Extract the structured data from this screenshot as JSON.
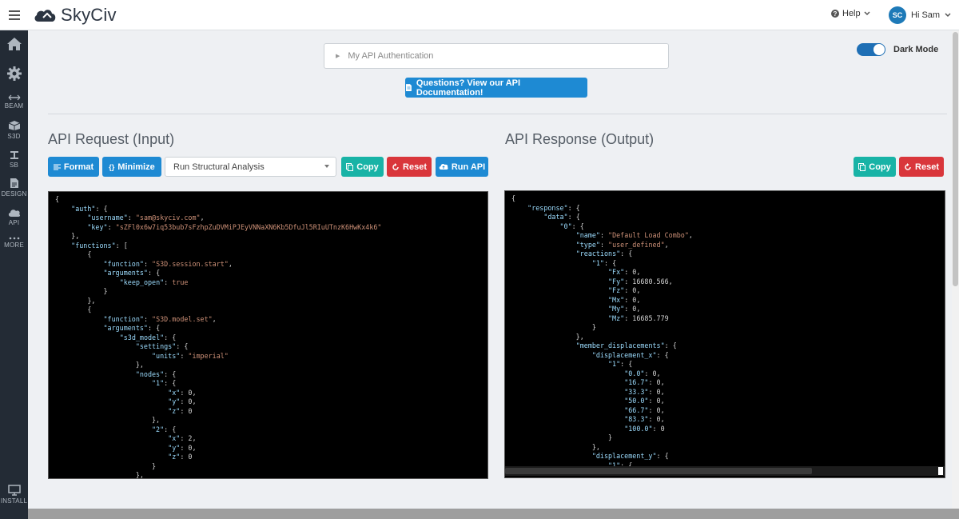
{
  "app": {
    "brand": "SkyCiv",
    "help_label": "Help",
    "user_initials": "SC",
    "user_greeting": "Hi Sam"
  },
  "sidebar": [
    {
      "name": "home",
      "icon": "home-icon",
      "label": ""
    },
    {
      "name": "settings",
      "icon": "gear-icon",
      "label": ""
    },
    {
      "name": "beam",
      "icon": "beam-icon",
      "label": "BEAM"
    },
    {
      "name": "s3d",
      "icon": "cube-icon",
      "label": "S3D"
    },
    {
      "name": "sb",
      "icon": "section-icon",
      "label": "SB"
    },
    {
      "name": "design",
      "icon": "document-icon",
      "label": "DESIGN"
    },
    {
      "name": "api",
      "icon": "cloud-icon",
      "label": "API"
    },
    {
      "name": "more",
      "icon": "dots-icon",
      "label": "MORE"
    },
    {
      "name": "install",
      "icon": "monitor-icon",
      "label": "INSTALL"
    }
  ],
  "auth": {
    "label": "My API Authentication"
  },
  "docs_button": "Questions? View our API Documentation!",
  "dark_mode": {
    "label": "Dark Mode",
    "enabled": true
  },
  "request": {
    "title": "API Request (Input)",
    "format_label": "Format",
    "minimize_label": "Minimize",
    "selected_function": "Run Structural Analysis",
    "copy_label": "Copy",
    "reset_label": "Reset",
    "run_label": "Run API",
    "code": [
      "{",
      "    \"auth\": {",
      "        \"username\": \"sam@skyciv.com\",",
      "        \"key\": \"sZFl0x6w7iq53bub7sFzhpZuDVMiPJEyVNNaXN6Kb5DfuJl5RIuUTnzK6HwKx4k6\"",
      "    },",
      "    \"functions\": [",
      "        {",
      "            \"function\": \"S3D.session.start\",",
      "            \"arguments\": {",
      "                \"keep_open\": true",
      "            }",
      "        },",
      "        {",
      "            \"function\": \"S3D.model.set\",",
      "            \"arguments\": {",
      "                \"s3d_model\": {",
      "                    \"settings\": {",
      "                        \"units\": \"imperial\"",
      "                    },",
      "                    \"nodes\": {",
      "                        \"1\": {",
      "                            \"x\": 0,",
      "                            \"y\": 0,",
      "                            \"z\": 0",
      "                        },",
      "                        \"2\": {",
      "                            \"x\": 2,",
      "                            \"y\": 0,",
      "                            \"z\": 0",
      "                        }",
      "                    },"
    ]
  },
  "response": {
    "title": "API Response (Output)",
    "copy_label": "Copy",
    "reset_label": "Reset",
    "code": [
      "{",
      "    \"response\": {",
      "        \"data\": {",
      "            \"0\": {",
      "                \"name\": \"Default Load Combo\",",
      "                \"type\": \"user_defined\",",
      "                \"reactions\": {",
      "                    \"1\": {",
      "                        \"Fx\": 0,",
      "                        \"Fy\": 16680.566,",
      "                        \"Fz\": 0,",
      "                        \"Mx\": 0,",
      "                        \"My\": 0,",
      "                        \"Mz\": 16685.779",
      "                    }",
      "                },",
      "                \"member_displacements\": {",
      "                    \"displacement_x\": {",
      "                        \"1\": {",
      "                            \"0.0\": 0,",
      "                            \"16.7\": 0,",
      "                            \"33.3\": 0,",
      "                            \"50.0\": 0,",
      "                            \"66.7\": 0,",
      "                            \"83.3\": 0,",
      "                            \"100.0\": 0",
      "                        }",
      "                    },",
      "                    \"displacement_y\": {",
      "                        \"1\": {"
    ]
  }
}
